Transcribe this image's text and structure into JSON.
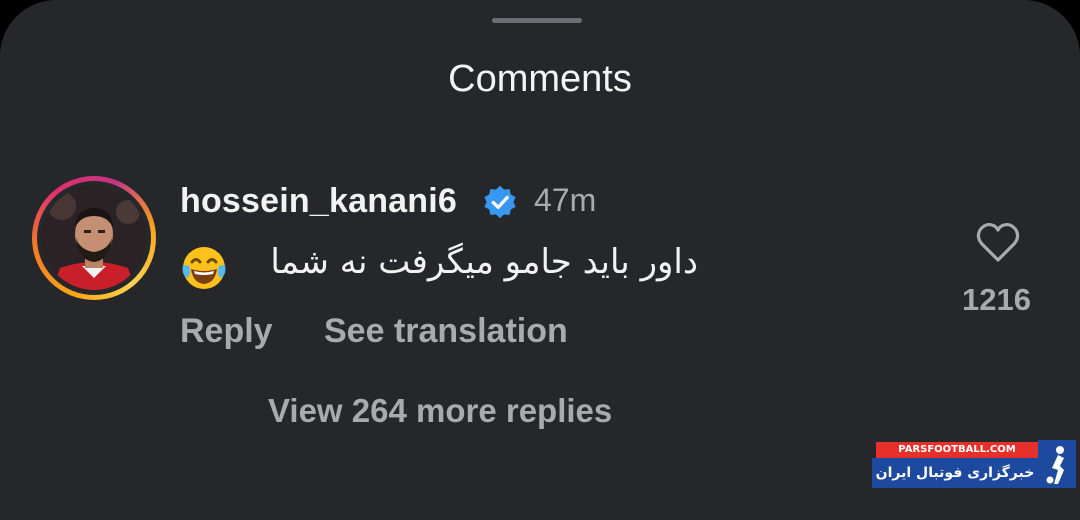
{
  "header": {
    "title": "Comments"
  },
  "comment": {
    "username": "hossein_kanani6",
    "verified": true,
    "time": "47m",
    "text": "داور باید جامو میگرفت نه شما",
    "emoji": "face-with-tears-of-joy-icon",
    "reply_label": "Reply",
    "translate_label": "See translation",
    "likes": "1216",
    "view_more_label": "View 264 more replies"
  },
  "watermark": {
    "site": "PARSFOOTBALL.COM",
    "tagline": "خبرگزاری فوتبال ایران"
  },
  "colors": {
    "background": "#26272b",
    "text_primary": "#f2f2f2",
    "text_secondary": "#a9aaae",
    "verified": "#3897f0"
  }
}
